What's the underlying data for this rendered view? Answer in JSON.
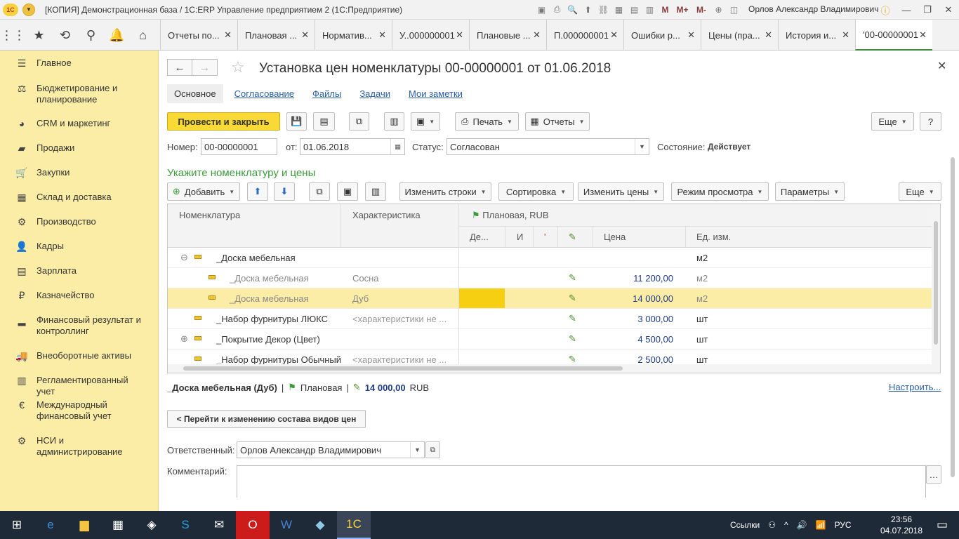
{
  "window": {
    "title": "[КОПИЯ] Демонстрационная база / 1С:ERP Управление предприятием 2 (1С:Предприятие)",
    "user": "Орлов Александр Владимирович",
    "logo_text": "1С"
  },
  "tabs": [
    {
      "label": "Отчеты по..."
    },
    {
      "label": "Плановая ..."
    },
    {
      "label": "Норматив..."
    },
    {
      "label": "У..000000001"
    },
    {
      "label": "Плановые ..."
    },
    {
      "label": "П.000000001"
    },
    {
      "label": "Ошибки р..."
    },
    {
      "label": "Цены (пра..."
    },
    {
      "label": "История и..."
    },
    {
      "label": "'00-00000001"
    }
  ],
  "sidebar": {
    "items": [
      {
        "label": "Главное",
        "icon": "menu-icon"
      },
      {
        "label": "Бюджетирование и планирование",
        "icon": "budget-icon"
      },
      {
        "label": "CRM и маркетинг",
        "icon": "crm-icon"
      },
      {
        "label": "Продажи",
        "icon": "sales-icon"
      },
      {
        "label": "Закупки",
        "icon": "purchases-icon"
      },
      {
        "label": "Склад и доставка",
        "icon": "warehouse-icon"
      },
      {
        "label": "Производство",
        "icon": "production-icon"
      },
      {
        "label": "Кадры",
        "icon": "hr-icon"
      },
      {
        "label": "Зарплата",
        "icon": "salary-icon"
      },
      {
        "label": "Казначейство",
        "icon": "treasury-icon"
      },
      {
        "label": "Финансовый результат и контроллинг",
        "icon": "finance-icon"
      },
      {
        "label": "Внеоборотные активы",
        "icon": "assets-icon"
      },
      {
        "label": "Регламентированный учет",
        "icon": "accounting-icon"
      },
      {
        "label": "Международный финансовый учет",
        "icon": "intl-finance-icon"
      },
      {
        "label": "НСИ и администрирование",
        "icon": "admin-icon"
      }
    ]
  },
  "document": {
    "title": "Установка цен номенклатуры 00-00000001 от 01.06.2018",
    "subtabs": [
      "Основное",
      "Согласование",
      "Файлы",
      "Задачи",
      "Мои заметки"
    ],
    "toolbar": {
      "post_close": "Провести и закрыть",
      "print": "Печать",
      "reports": "Отчеты",
      "more": "Еще",
      "help": "?"
    },
    "number_label": "Номер:",
    "number_value": "00-00000001",
    "date_label": "от:",
    "date_value": "01.06.2018",
    "status_label": "Статус:",
    "status_value": "Согласован",
    "state_label": "Состояние:",
    "state_value": "Действует",
    "section_title": "Укажите номенклатуру и цены",
    "table_toolbar": {
      "add": "Добавить",
      "change_rows": "Изменить строки",
      "sort": "Сортировка",
      "change_prices": "Изменить цены",
      "view_mode": "Режим просмотра",
      "params": "Параметры",
      "more": "Еще"
    },
    "table": {
      "headers": {
        "nomenclature": "Номенклатура",
        "characteristic": "Характеристика",
        "price_type": "Плановая, RUB",
        "de": "Де...",
        "i": "И",
        "q": "'",
        "price": "Цена",
        "unit": "Ед. изм."
      },
      "rows": [
        {
          "name": "_Доска мебельная",
          "characteristic": "",
          "price": "",
          "unit": "м2",
          "level": 0,
          "group": true
        },
        {
          "name": "_Доска мебельная",
          "characteristic": "Сосна",
          "price": "11 200,00",
          "unit": "м2",
          "level": 1
        },
        {
          "name": "_Доска мебельная",
          "characteristic": "Дуб",
          "price": "14 000,00",
          "unit": "м2",
          "level": 1,
          "selected": true
        },
        {
          "name": "_Набор фурнитуры ЛЮКС",
          "characteristic": "<характеристики не ...",
          "price": "3 000,00",
          "unit": "шт",
          "level": 0
        },
        {
          "name": "_Покрытие Декор (Цвет)",
          "characteristic": "",
          "price": "4 500,00",
          "unit": "шт",
          "level": 0,
          "group": true
        },
        {
          "name": "_Набор фурнитуры Обычный",
          "characteristic": "<характеристики не ...",
          "price": "2 500,00",
          "unit": "шт",
          "level": 0
        }
      ]
    },
    "summary": {
      "item": "_Доска мебельная (Дуб)",
      "sep": "|",
      "price_type": "Плановая",
      "sep2": "|",
      "amount": "14 000,00",
      "currency": "RUB"
    },
    "configure_link": "Настроить...",
    "goto_button": "< Перейти к изменению состава видов цен",
    "responsible_label": "Ответственный:",
    "responsible_value": "Орлов Александр Владимирович",
    "comment_label": "Комментарий:",
    "comment_value": ""
  },
  "taskbar": {
    "search_text": "Ссылки",
    "lang": "РУС",
    "time": "23:56",
    "date": "04.07.2018"
  }
}
